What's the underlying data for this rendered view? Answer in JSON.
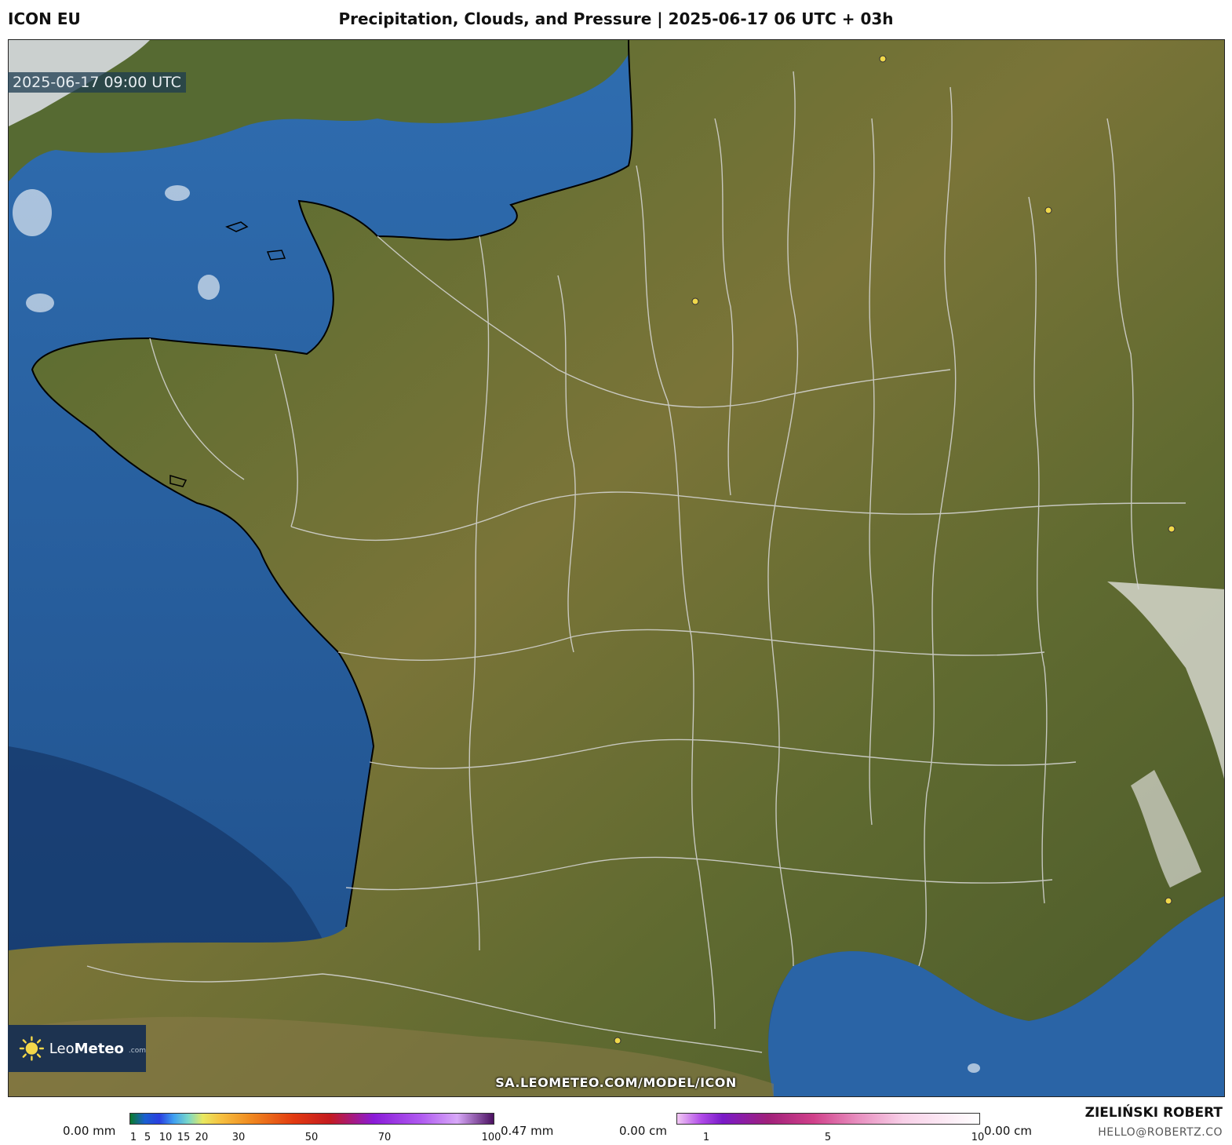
{
  "header": {
    "model": "ICON EU",
    "title": "Precipitation, Clouds, and Pressure | 2025-06-17 06 UTC + 03h"
  },
  "map": {
    "valid_time": "2025-06-17 09:00 UTC",
    "url": "SA.LEOMETEO.COM/MODEL/ICON",
    "logo": {
      "brand_light": "Leo",
      "brand_bold": "Meteo",
      "suffix": ".com"
    },
    "colors": {
      "sea": "#2c6aa8",
      "land": "#5c6a34",
      "borders": "#d8d8d8",
      "coast": "#000000",
      "city": "#f0d84a"
    },
    "icons": [
      "sun-icon",
      "city-dot-icon"
    ]
  },
  "legend": {
    "precip": {
      "min_label": "0.00 mm",
      "max_label": "0.47 mm",
      "ticks": [
        "1",
        "5",
        "10",
        "15",
        "20",
        "30",
        "50",
        "70",
        "100"
      ]
    },
    "snow": {
      "min_label": "0.00 cm",
      "max_label": "0.00 cm",
      "ticks": [
        "1",
        "5",
        "10"
      ]
    }
  },
  "footer": {
    "author": "ZIELIŃSKI ROBERT",
    "email": "HELLO@ROBERTZ.CO"
  }
}
